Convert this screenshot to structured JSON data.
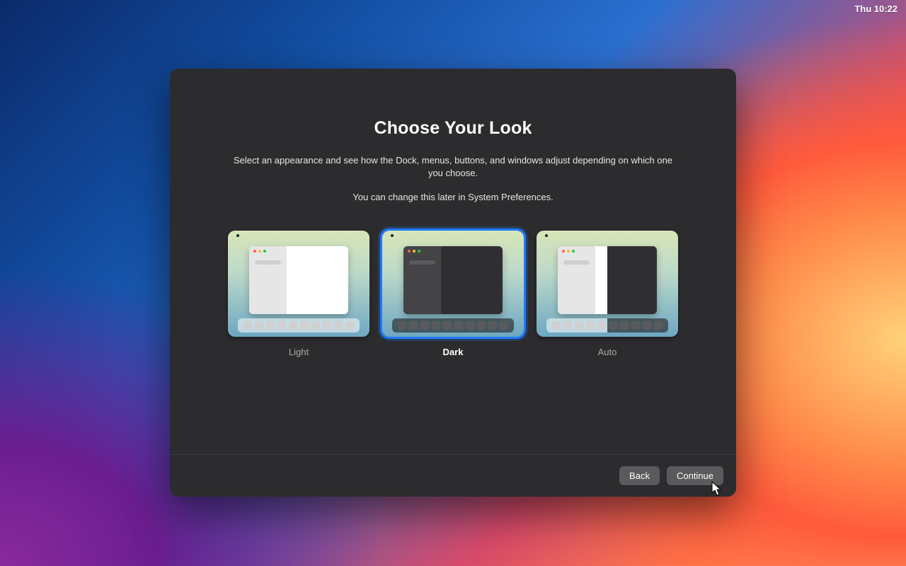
{
  "menubar": {
    "clock": "Thu 10:22"
  },
  "dialog": {
    "title": "Choose Your Look",
    "description": "Select an appearance and see how the Dock, menus, buttons, and windows adjust depending on which one you choose.",
    "note": "You can change this later in System Preferences.",
    "options": [
      {
        "id": "light",
        "label": "Light",
        "selected": false
      },
      {
        "id": "dark",
        "label": "Dark",
        "selected": true
      },
      {
        "id": "auto",
        "label": "Auto",
        "selected": false
      }
    ],
    "buttons": {
      "back": "Back",
      "continue": "Continue"
    }
  }
}
